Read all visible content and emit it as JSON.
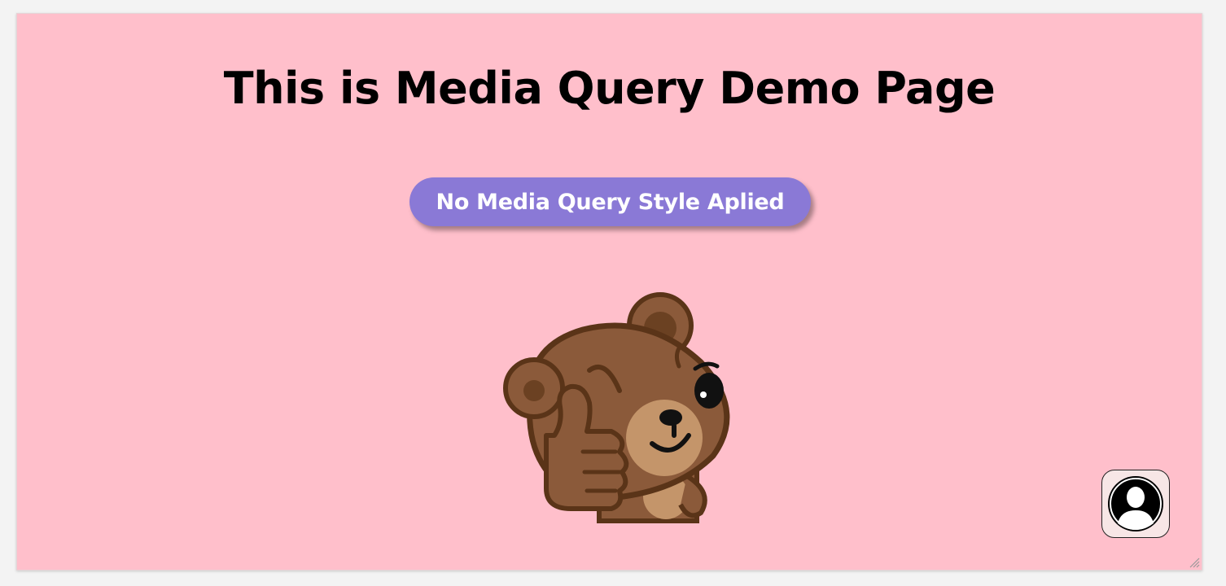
{
  "page": {
    "title": "This is Media Query Demo Page",
    "status_label": "No Media Query Style Aplied"
  },
  "colors": {
    "background": "#ffbfcb",
    "pill": "#8a79d6",
    "pill_text": "#ffffff",
    "title_text": "#000000"
  },
  "icons": {
    "bear": "bear-thumbs-up-icon",
    "avatar": "user-avatar-icon",
    "resize": "resize-grip-icon"
  }
}
